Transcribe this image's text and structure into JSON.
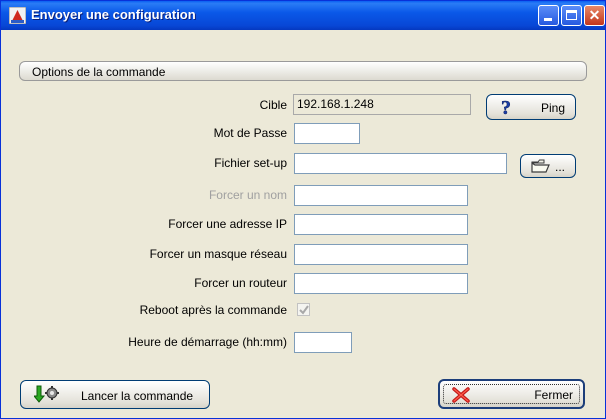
{
  "window": {
    "title": "Envoyer une configuration"
  },
  "group": {
    "title": "Options de la commande"
  },
  "form": {
    "cible_label": "Cible",
    "cible_value": "192.168.1.248",
    "mot_de_passe_label": "Mot de Passe",
    "mot_de_passe_value": "",
    "fichier_label": "Fichier set-up",
    "fichier_value": "",
    "forcer_nom_label": "Forcer un nom",
    "forcer_nom_value": "",
    "forcer_ip_label": "Forcer une adresse IP",
    "forcer_ip_value": "",
    "forcer_masque_label": "Forcer un masque réseau",
    "forcer_masque_value": "",
    "forcer_routeur_label": "Forcer un routeur",
    "forcer_routeur_value": "",
    "reboot_label": "Reboot après la commande",
    "reboot_checked": true,
    "heure_label": "Heure de démarrage (hh:mm)",
    "heure_value": ""
  },
  "buttons": {
    "ping_label": "Ping",
    "browse_label": "...",
    "lancer_label": "Lancer la commande",
    "fermer_label": "Fermer"
  },
  "icons": {
    "ping": "question-mark-icon",
    "browse": "folder-open-icon",
    "lancer": "run-command-icon",
    "fermer": "red-x-icon"
  }
}
